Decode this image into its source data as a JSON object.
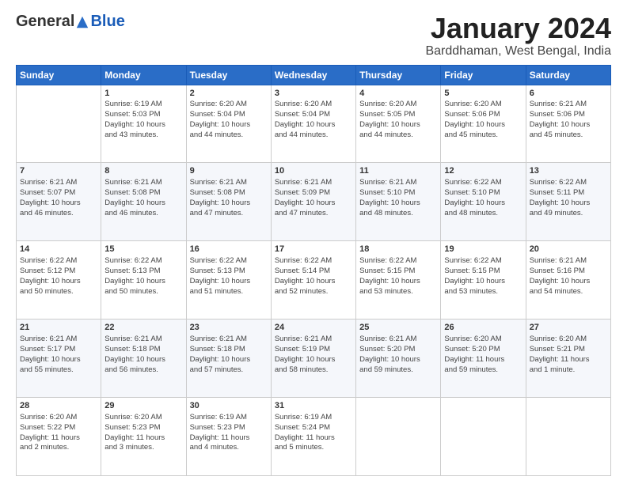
{
  "logo": {
    "general": "General",
    "blue": "Blue"
  },
  "title": "January 2024",
  "location": "Barddhaman, West Bengal, India",
  "days": [
    "Sunday",
    "Monday",
    "Tuesday",
    "Wednesday",
    "Thursday",
    "Friday",
    "Saturday"
  ],
  "weeks": [
    [
      {
        "date": "",
        "info": ""
      },
      {
        "date": "1",
        "info": "Sunrise: 6:19 AM\nSunset: 5:03 PM\nDaylight: 10 hours\nand 43 minutes."
      },
      {
        "date": "2",
        "info": "Sunrise: 6:20 AM\nSunset: 5:04 PM\nDaylight: 10 hours\nand 44 minutes."
      },
      {
        "date": "3",
        "info": "Sunrise: 6:20 AM\nSunset: 5:04 PM\nDaylight: 10 hours\nand 44 minutes."
      },
      {
        "date": "4",
        "info": "Sunrise: 6:20 AM\nSunset: 5:05 PM\nDaylight: 10 hours\nand 44 minutes."
      },
      {
        "date": "5",
        "info": "Sunrise: 6:20 AM\nSunset: 5:06 PM\nDaylight: 10 hours\nand 45 minutes."
      },
      {
        "date": "6",
        "info": "Sunrise: 6:21 AM\nSunset: 5:06 PM\nDaylight: 10 hours\nand 45 minutes."
      }
    ],
    [
      {
        "date": "7",
        "info": "Sunrise: 6:21 AM\nSunset: 5:07 PM\nDaylight: 10 hours\nand 46 minutes."
      },
      {
        "date": "8",
        "info": "Sunrise: 6:21 AM\nSunset: 5:08 PM\nDaylight: 10 hours\nand 46 minutes."
      },
      {
        "date": "9",
        "info": "Sunrise: 6:21 AM\nSunset: 5:08 PM\nDaylight: 10 hours\nand 47 minutes."
      },
      {
        "date": "10",
        "info": "Sunrise: 6:21 AM\nSunset: 5:09 PM\nDaylight: 10 hours\nand 47 minutes."
      },
      {
        "date": "11",
        "info": "Sunrise: 6:21 AM\nSunset: 5:10 PM\nDaylight: 10 hours\nand 48 minutes."
      },
      {
        "date": "12",
        "info": "Sunrise: 6:22 AM\nSunset: 5:10 PM\nDaylight: 10 hours\nand 48 minutes."
      },
      {
        "date": "13",
        "info": "Sunrise: 6:22 AM\nSunset: 5:11 PM\nDaylight: 10 hours\nand 49 minutes."
      }
    ],
    [
      {
        "date": "14",
        "info": "Sunrise: 6:22 AM\nSunset: 5:12 PM\nDaylight: 10 hours\nand 50 minutes."
      },
      {
        "date": "15",
        "info": "Sunrise: 6:22 AM\nSunset: 5:13 PM\nDaylight: 10 hours\nand 50 minutes."
      },
      {
        "date": "16",
        "info": "Sunrise: 6:22 AM\nSunset: 5:13 PM\nDaylight: 10 hours\nand 51 minutes."
      },
      {
        "date": "17",
        "info": "Sunrise: 6:22 AM\nSunset: 5:14 PM\nDaylight: 10 hours\nand 52 minutes."
      },
      {
        "date": "18",
        "info": "Sunrise: 6:22 AM\nSunset: 5:15 PM\nDaylight: 10 hours\nand 53 minutes."
      },
      {
        "date": "19",
        "info": "Sunrise: 6:22 AM\nSunset: 5:15 PM\nDaylight: 10 hours\nand 53 minutes."
      },
      {
        "date": "20",
        "info": "Sunrise: 6:21 AM\nSunset: 5:16 PM\nDaylight: 10 hours\nand 54 minutes."
      }
    ],
    [
      {
        "date": "21",
        "info": "Sunrise: 6:21 AM\nSunset: 5:17 PM\nDaylight: 10 hours\nand 55 minutes."
      },
      {
        "date": "22",
        "info": "Sunrise: 6:21 AM\nSunset: 5:18 PM\nDaylight: 10 hours\nand 56 minutes."
      },
      {
        "date": "23",
        "info": "Sunrise: 6:21 AM\nSunset: 5:18 PM\nDaylight: 10 hours\nand 57 minutes."
      },
      {
        "date": "24",
        "info": "Sunrise: 6:21 AM\nSunset: 5:19 PM\nDaylight: 10 hours\nand 58 minutes."
      },
      {
        "date": "25",
        "info": "Sunrise: 6:21 AM\nSunset: 5:20 PM\nDaylight: 10 hours\nand 59 minutes."
      },
      {
        "date": "26",
        "info": "Sunrise: 6:20 AM\nSunset: 5:20 PM\nDaylight: 11 hours\nand 59 minutes."
      },
      {
        "date": "27",
        "info": "Sunrise: 6:20 AM\nSunset: 5:21 PM\nDaylight: 11 hours\nand 1 minute."
      }
    ],
    [
      {
        "date": "28",
        "info": "Sunrise: 6:20 AM\nSunset: 5:22 PM\nDaylight: 11 hours\nand 2 minutes."
      },
      {
        "date": "29",
        "info": "Sunrise: 6:20 AM\nSunset: 5:23 PM\nDaylight: 11 hours\nand 3 minutes."
      },
      {
        "date": "30",
        "info": "Sunrise: 6:19 AM\nSunset: 5:23 PM\nDaylight: 11 hours\nand 4 minutes."
      },
      {
        "date": "31",
        "info": "Sunrise: 6:19 AM\nSunset: 5:24 PM\nDaylight: 11 hours\nand 5 minutes."
      },
      {
        "date": "",
        "info": ""
      },
      {
        "date": "",
        "info": ""
      },
      {
        "date": "",
        "info": ""
      }
    ]
  ]
}
